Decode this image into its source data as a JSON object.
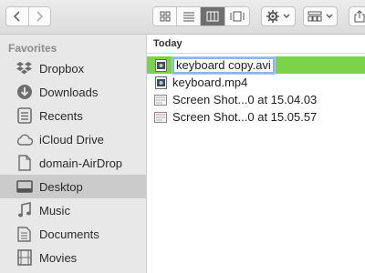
{
  "sidebar": {
    "heading": "Favorites",
    "items": [
      {
        "label": "Dropbox",
        "icon": "dropbox-icon"
      },
      {
        "label": "Downloads",
        "icon": "downloads-icon"
      },
      {
        "label": "Recents",
        "icon": "recents-icon"
      },
      {
        "label": "iCloud Drive",
        "icon": "cloud-icon"
      },
      {
        "label": "domain-AirDrop",
        "icon": "document-icon"
      },
      {
        "label": "Desktop",
        "icon": "desktop-icon",
        "selected": true
      },
      {
        "label": "Music",
        "icon": "music-icon"
      },
      {
        "label": "Documents",
        "icon": "documents-icon"
      },
      {
        "label": "Movies",
        "icon": "movies-icon"
      }
    ]
  },
  "main": {
    "column_header": "Today",
    "files": [
      {
        "name": "keyboard copy.avi",
        "type": "video",
        "selected": true,
        "editing": true
      },
      {
        "name": "keyboard.mp4",
        "type": "video"
      },
      {
        "name": "Screen Shot...0 at 15.04.03",
        "type": "image"
      },
      {
        "name": "Screen Shot...0 at 15.05.57",
        "type": "image"
      }
    ]
  },
  "colors": {
    "selection_green": "#7bd349",
    "sidebar_bg": "#e8e8e8",
    "sidebar_selected": "#cbcbcb",
    "edit_border": "#8fb5e8"
  }
}
